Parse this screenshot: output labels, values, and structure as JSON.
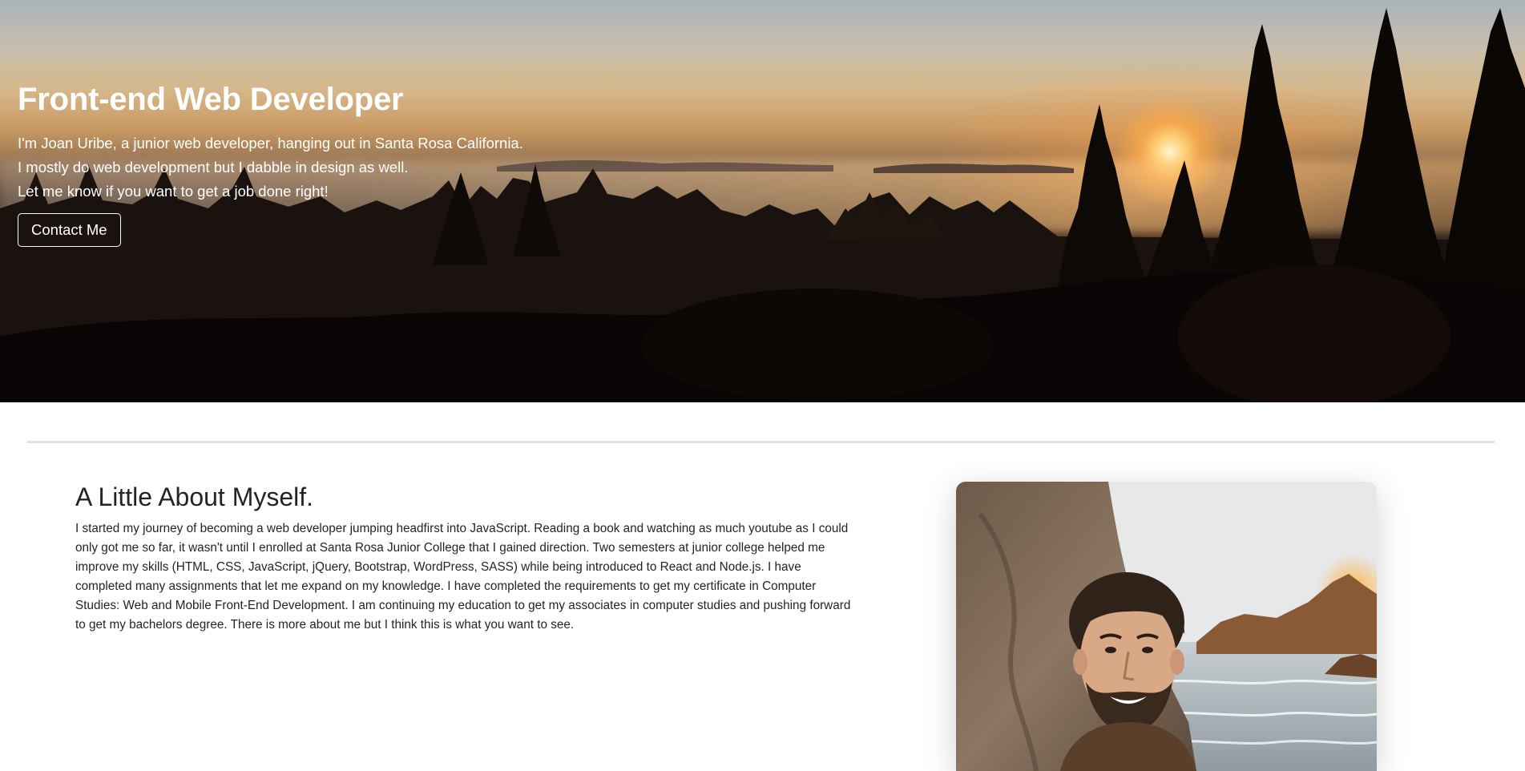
{
  "hero": {
    "title": "Front-end Web Developer",
    "lines": [
      "I'm Joan Uribe, a junior web developer, hanging out in Santa Rosa California.",
      "I mostly do web development but I dabble in design as well.",
      "Let me know if you want to get a job done right!"
    ],
    "button_label": "Contact Me"
  },
  "about": {
    "title": "A Little About Myself.",
    "text": "I started my journey of becoming a web developer jumping headfirst into JavaScript. Reading a book and watching as much youtube as I could only got me so far, it wasn't until I enrolled at Santa Rosa Junior College that I gained direction. Two semesters at junior college helped me improve my skills (HTML, CSS, JavaScript, jQuery, Bootstrap, WordPress, SASS) while being introduced to React and Node.js. I have completed many assignments that let me expand on my knowledge. I have completed the requirements to get my certificate in Computer Studies: Web and Mobile Front-End Development. I am continuing my education to get my associates in computer studies and pushing forward to get my bachelors degree. There is more about me but I think this is what you want to see."
  }
}
